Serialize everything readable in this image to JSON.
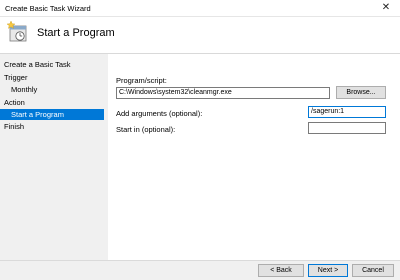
{
  "window": {
    "title": "Create Basic Task Wizard",
    "close": "✕"
  },
  "header": {
    "title": "Start a Program"
  },
  "steps": [
    {
      "label": "Create a Basic Task"
    },
    {
      "label": "Trigger"
    },
    {
      "label": "Monthly"
    },
    {
      "label": "Action"
    },
    {
      "label": "Start a Program"
    },
    {
      "label": "Finish"
    }
  ],
  "form": {
    "program_label": "Program/script:",
    "program_value": "C:\\Windows\\system32\\cleanmgr.exe",
    "browse_label": "Browse...",
    "args_label": "Add arguments (optional):",
    "args_value": "/sagerun:1",
    "startin_label": "Start in (optional):",
    "startin_value": ""
  },
  "buttons": {
    "back": "< Back",
    "next": "Next >",
    "cancel": "Cancel"
  },
  "colors": {
    "accent": "#0078d7",
    "pane": "#f0f0f0"
  }
}
